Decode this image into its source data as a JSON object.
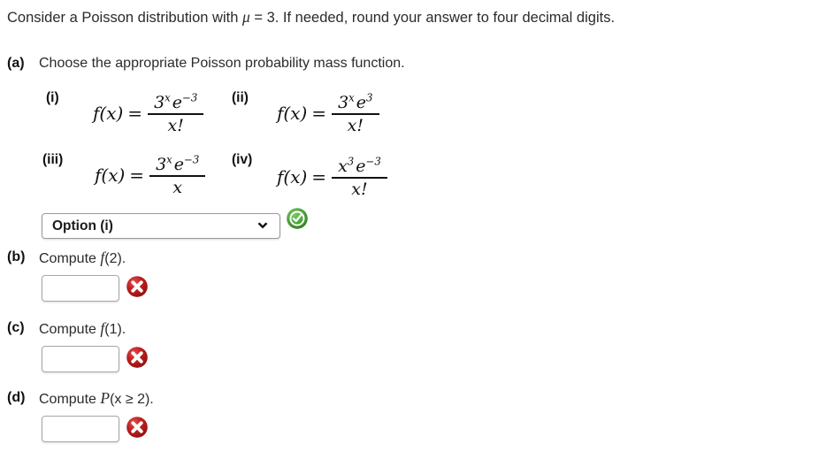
{
  "prompt": {
    "before_mu": "Consider a Poisson distribution with ",
    "mu_symbol": "μ",
    "after_mu": " = 3. If needed, round your answer to four decimal digits."
  },
  "parts": {
    "a": {
      "label": "(a)",
      "text": "Choose the appropriate Poisson probability mass function.",
      "options": [
        {
          "tag": "(i)",
          "lhs": "f(x)",
          "eq": "=",
          "numerator": "3ˣ e⁻³",
          "denominator": "x!",
          "base": "3",
          "base_exp": "x",
          "e_exp": "−3",
          "den": "x!"
        },
        {
          "tag": "(ii)",
          "lhs": "f(x)",
          "eq": "=",
          "numerator": "3ˣ e³",
          "denominator": "x!",
          "base": "3",
          "base_exp": "x",
          "e_exp": "3",
          "den": "x!"
        },
        {
          "tag": "(iii)",
          "lhs": "f(x)",
          "eq": "=",
          "numerator": "3ˣ e⁻³",
          "denominator": "x",
          "base": "3",
          "base_exp": "x",
          "e_exp": "−3",
          "den": "x"
        },
        {
          "tag": "(iv)",
          "lhs": "f(x)",
          "eq": "=",
          "numerator": "x³ e⁻³",
          "denominator": "x!",
          "base": "x",
          "base_exp": "3",
          "e_exp": "−3",
          "den": "x!"
        }
      ],
      "select": {
        "value": "Option (i)",
        "chevron_icon": "chevron-down-icon"
      },
      "status": {
        "icon": "correct-check-icon",
        "state": "correct"
      }
    },
    "b": {
      "label": "(b)",
      "text_before": "Compute ",
      "fn": "f",
      "text_after": "(2).",
      "input_value": "",
      "status": {
        "icon": "incorrect-x-icon",
        "state": "incorrect"
      }
    },
    "c": {
      "label": "(c)",
      "text_before": "Compute ",
      "fn": "f",
      "text_after": "(1).",
      "input_value": "",
      "status": {
        "icon": "incorrect-x-icon",
        "state": "incorrect"
      }
    },
    "d": {
      "label": "(d)",
      "text_before": "Compute ",
      "fn": "P",
      "text_after": "(x ≥ 2).",
      "input_value": "",
      "status": {
        "icon": "incorrect-x-icon",
        "state": "incorrect"
      }
    }
  },
  "colors": {
    "correct_green": "#3b8b2e",
    "incorrect_red": "#b81d1d",
    "text": "#2b2b2b",
    "input_border": "#a8a8a8"
  }
}
